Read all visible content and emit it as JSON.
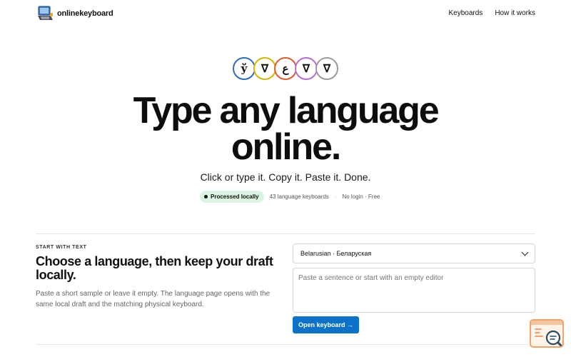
{
  "header": {
    "brand": "onlinekeyboard",
    "nav": [
      {
        "label": "Keyboards"
      },
      {
        "label": "How it works"
      }
    ]
  },
  "hero": {
    "glyphs": [
      {
        "char": "ў",
        "color": "#2d6fb7"
      },
      {
        "char": "ᐁ",
        "color": "#d8b300"
      },
      {
        "char": "ع",
        "color": "#e05a2a"
      },
      {
        "char": "ᐁ",
        "color": "#b86bd0"
      },
      {
        "char": "ᐁ",
        "color": "#9a9aa0"
      }
    ],
    "title_line1": "Type any language",
    "title_line2": "online.",
    "subtitle": "Click or type it. Copy it. Paste it. Done.",
    "badge": "Processed locally",
    "keyboards_count": "43 language keyboards",
    "separator": "·",
    "login_free": "No login · Free"
  },
  "start": {
    "eyebrow": "START WITH TEXT",
    "title": "Choose a language, then keep your draft locally.",
    "description": "Paste a short sample or leave it empty. The language page opens with the same local draft and the matching physical keyboard.",
    "selected_language": "Belarusian · Беларуская",
    "draft_placeholder": "Paste a sentence or start with an empty editor",
    "open_button": "Open keyboard →"
  },
  "colors": {
    "accent": "#0a73c9",
    "badge_bg": "#dcf5e3",
    "widget_border": "#f2a36a"
  },
  "icons": {
    "brand": "laptop-keyboard-icon",
    "select": "chevron-down-icon",
    "widget": "search-magnifier-icon"
  }
}
